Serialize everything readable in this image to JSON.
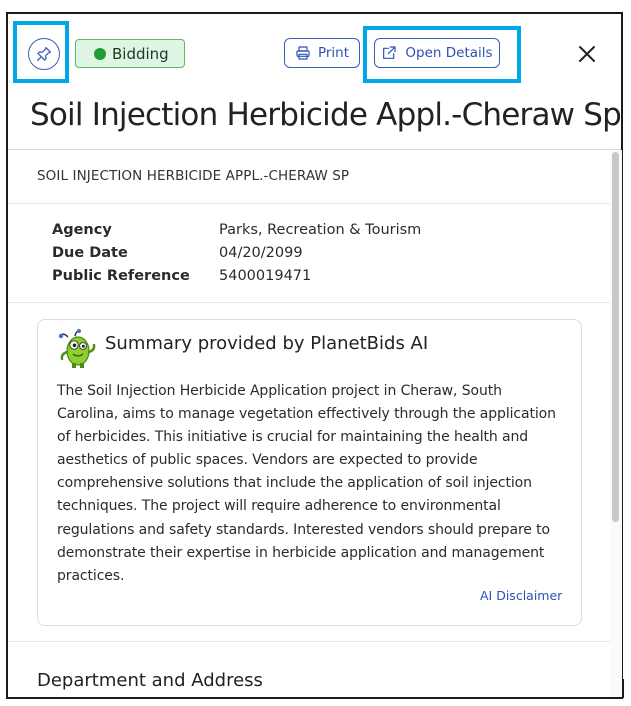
{
  "header": {
    "status": "Bidding",
    "print_label": "Print",
    "open_details_label": "Open Details",
    "title": "Soil Injection Herbicide Appl.-Cheraw Sp"
  },
  "bid": {
    "subtitle": "SOIL INJECTION HERBICIDE APPL.-CHERAW SP",
    "meta": [
      {
        "label": "Agency",
        "value": "Parks, Recreation & Tourism"
      },
      {
        "label": "Due Date",
        "value": "04/20/2099"
      },
      {
        "label": "Public Reference",
        "value": "5400019471"
      }
    ]
  },
  "ai_summary": {
    "heading": "Summary provided by PlanetBids AI",
    "body": "The Soil Injection Herbicide Application project in Cheraw, South Carolina, aims to manage vegetation effectively through the application of herbicides. This initiative is crucial for maintaining the health and aesthetics of public spaces. Vendors are expected to provide comprehensive solutions that include the application of soil injection techniques. The project will require adherence to environmental regulations and safety standards. Interested vendors should prepare to demonstrate their expertise in herbicide application and management practices.",
    "disclaimer": "AI Disclaimer"
  },
  "sections": {
    "department_heading": "Department and Address"
  },
  "icons": {
    "pin": "pin-icon",
    "print": "printer-icon",
    "open": "external-link-icon",
    "close": "close-icon",
    "ai": "robot-mascot-icon"
  },
  "colors": {
    "highlight": "#00a8e8",
    "accent": "#2c52b3",
    "status_bg": "#dff5e3",
    "status_dot": "#1e9e34"
  }
}
